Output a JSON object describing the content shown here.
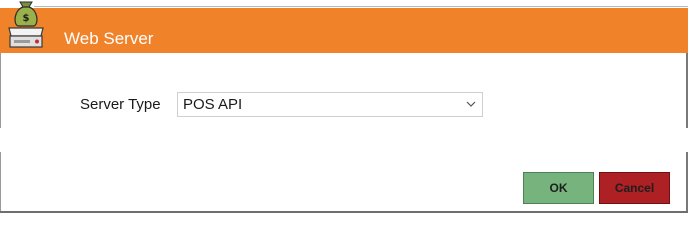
{
  "window": {
    "title": "Web Server",
    "icon": "server-money-icon",
    "titlebar_color": "#f0822a"
  },
  "form": {
    "server_type_label": "Server Type",
    "server_type_value": "POS API"
  },
  "buttons": {
    "ok_label": "OK",
    "cancel_label": "Cancel",
    "ok_color": "#77b37d",
    "cancel_color": "#ad2024"
  }
}
